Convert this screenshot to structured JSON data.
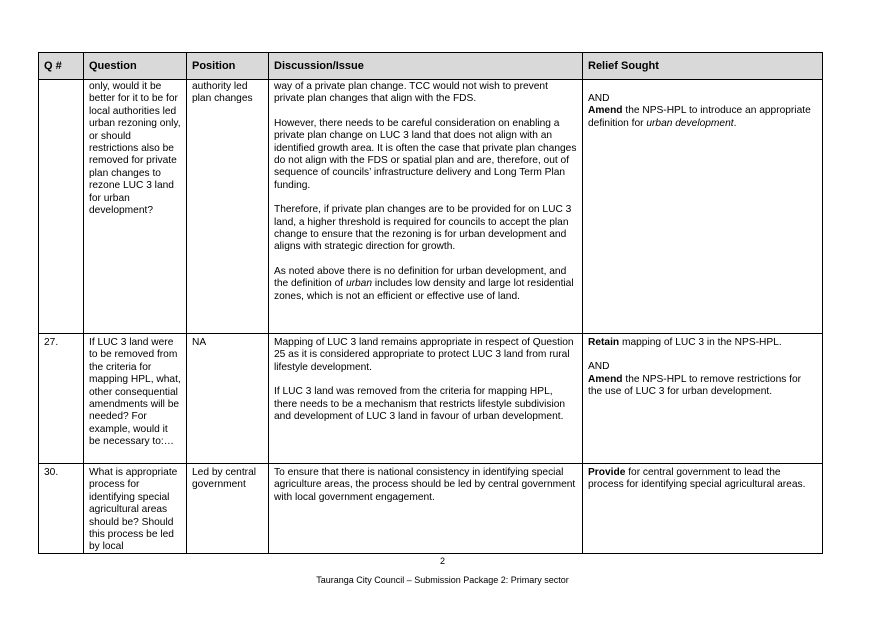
{
  "table": {
    "headers": {
      "q": "Q #",
      "question": "Question",
      "position": "Position",
      "discussion": "Discussion/Issue",
      "relief": "Relief Sought"
    },
    "row1": {
      "q": "",
      "question": "only, would it be better for it to be for local authorities led urban rezoning only, or should restrictions also be removed for private plan changes to rezone LUC 3 land for urban development?",
      "position": "authority led plan changes",
      "discussion": [
        "way of a private plan change. TCC would not wish to prevent private plan changes that align with the FDS.",
        "However, there needs to be careful consideration on enabling a private plan change on LUC 3 land that does not align with an identified growth area. It is often the case that private plan changes do not align with the FDS or spatial plan and are, therefore, out of sequence of councils’ infrastructure delivery and Long Term Plan funding.",
        "Therefore, if private plan changes are to be provided for on LUC 3 land, a higher threshold is required for councils to accept the plan change to ensure that the rezoning is for urban development and aligns with strategic direction for growth."
      ],
      "discussion_last": {
        "before": "As noted above there is no definition for urban development, and the definition of ",
        "italic": "urban",
        "after": " includes low density and large lot residential zones, which is not an efficient or effective use of land."
      },
      "relief": {
        "and": "AND",
        "bold": "Amend",
        "text": " the NPS-HPL to introduce an appropriate definition for ",
        "italic": "urban development",
        "end": "."
      }
    },
    "row2": {
      "q": "27.",
      "question": "If LUC 3 land were to be removed from the criteria for mapping HPL, what, other consequential amendments will be needed? For example, would it be necessary to:…",
      "position": "NA",
      "discussion": [
        "Mapping of LUC 3 land remains appropriate in respect of Question 25 as it is considered appropriate to protect LUC 3 land from rural lifestyle development.",
        "If LUC 3 land was removed from the criteria for mapping HPL, there needs to be a mechanism that restricts lifestyle subdivision and development of LUC 3 land in favour of urban development."
      ],
      "relief": {
        "p1_bold": "Retain",
        "p1_text": " mapping of LUC 3 in the NPS-HPL.",
        "and": "AND",
        "p2_bold": "Amend",
        "p2_text": " the NPS-HPL to remove restrictions for the use of LUC 3 for urban development."
      }
    },
    "row3": {
      "q": "30.",
      "question": "What is appropriate process for identifying special agricultural areas should be? Should this process be led by local",
      "position": "Led by central government",
      "discussion": "To ensure that there is national consistency in identifying special agriculture areas, the process should be led by central government with local government engagement.",
      "relief": {
        "bold": "Provide",
        "text": " for central government to lead the process for identifying special agricultural areas."
      }
    }
  },
  "footer": {
    "page_number": "2",
    "text": "Tauranga City Council – Submission Package 2: Primary sector"
  }
}
